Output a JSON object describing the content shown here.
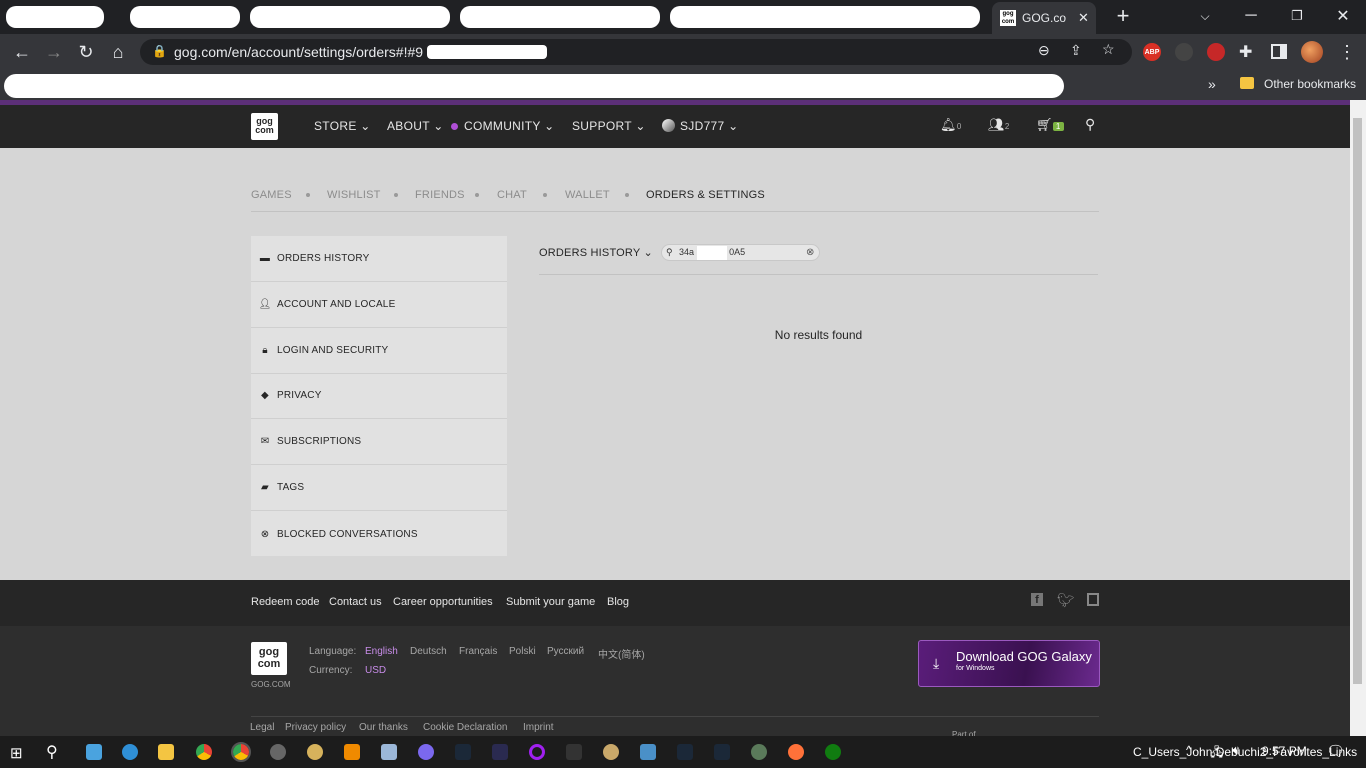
{
  "browser": {
    "active_tab_title": "GOG.co",
    "url": "gog.com/en/account/settings/orders#!#9",
    "other_bookmarks": "Other bookmarks"
  },
  "gog_nav": {
    "store": "STORE",
    "about": "ABOUT",
    "community": "COMMUNITY",
    "support": "SUPPORT",
    "username": "SJD777",
    "notif_count": "0",
    "friends_count": "2",
    "cart_count": "1"
  },
  "subnav": {
    "games": "GAMES",
    "wishlist": "WISHLIST",
    "friends": "FRIENDS",
    "chat": "CHAT",
    "wallet": "WALLET",
    "orders": "ORDERS & SETTINGS"
  },
  "menu": [
    {
      "label": "ORDERS HISTORY",
      "icon": "card-icon"
    },
    {
      "label": "ACCOUNT AND LOCALE",
      "icon": "user-icon"
    },
    {
      "label": "LOGIN AND SECURITY",
      "icon": "lock-icon"
    },
    {
      "label": "PRIVACY",
      "icon": "diamond-icon"
    },
    {
      "label": "SUBSCRIPTIONS",
      "icon": "mail-icon"
    },
    {
      "label": "TAGS",
      "icon": "tag-icon"
    },
    {
      "label": "BLOCKED CONVERSATIONS",
      "icon": "block-icon"
    }
  ],
  "orders": {
    "dropdown_label": "ORDERS HISTORY",
    "search_value": "34a",
    "search_value_tail": "0A5",
    "empty_message": "No results found"
  },
  "footer": {
    "links": [
      "Redeem code",
      "Contact us",
      "Career opportunities",
      "Submit your game",
      "Blog"
    ],
    "language_label": "Language:",
    "languages": [
      "English",
      "Deutsch",
      "Français",
      "Polski",
      "Русский",
      "中文(简体)"
    ],
    "currency_label": "Currency:",
    "currency": "USD",
    "gog_caption": "GOG.COM",
    "galaxy_title": "Download GOG Galaxy",
    "galaxy_sub": "for Windows",
    "legal_links": [
      "Legal",
      "Privacy policy",
      "Our thanks",
      "Cookie Declaration",
      "Imprint"
    ],
    "part_of": "Part of"
  },
  "taskbar": {
    "notification_text": "C_Users_John Debuchi2_Favorites_Links",
    "time": "9:57 PM"
  },
  "colors": {
    "accent_purple": "#9b59c0",
    "cart_badge": "#7cb342"
  }
}
